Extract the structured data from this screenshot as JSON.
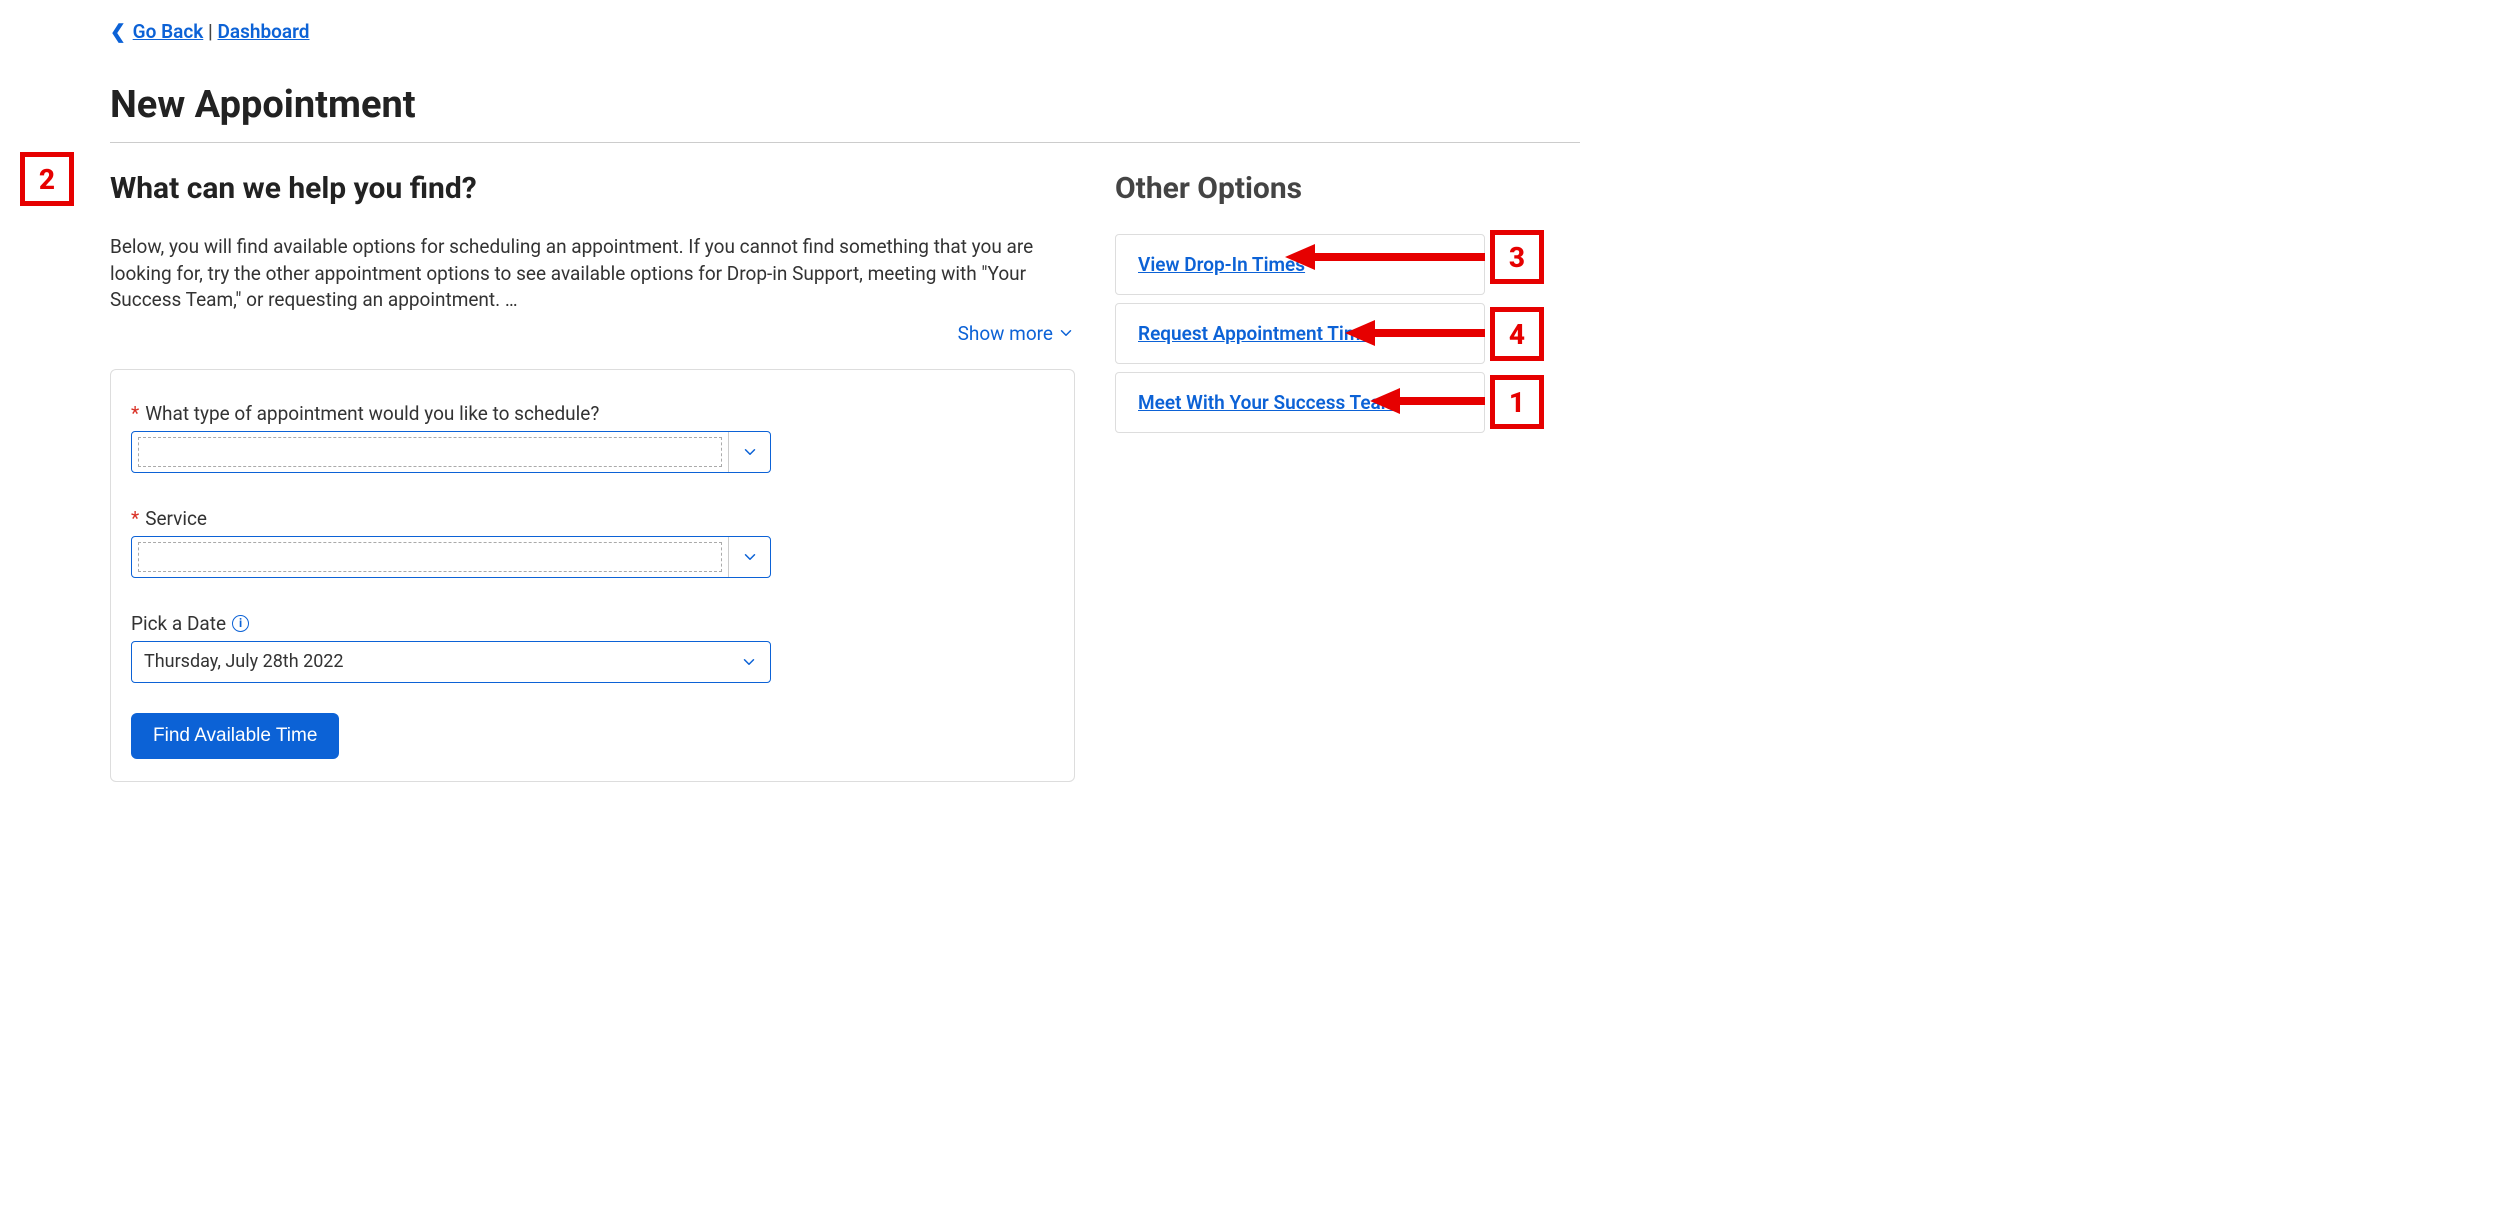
{
  "breadcrumb": {
    "go_back": "Go Back",
    "dashboard": "Dashboard"
  },
  "page_title": "New Appointment",
  "main": {
    "heading": "What can we help you find?",
    "help_text": "Below, you will find available options for scheduling an appointment. If you cannot find something that you are looking for, try the other appointment options to see available options for Drop-in Support, meeting with \"Your Success Team,\" or requesting an appointment. …",
    "show_more": "Show more",
    "form": {
      "appt_type_label": "What type of appointment would you like to schedule?",
      "appt_type_value": "",
      "service_label": "Service",
      "service_value": "",
      "date_label": "Pick a Date",
      "date_value": "Thursday, July 28th 2022",
      "submit_label": "Find Available Time"
    }
  },
  "sidebar": {
    "heading": "Other Options",
    "options": [
      {
        "label": "View Drop-In Times"
      },
      {
        "label": "Request Appointment Time"
      },
      {
        "label": "Meet With Your Success Team"
      }
    ]
  },
  "annotations": {
    "box1": "1",
    "box2": "2",
    "box3": "3",
    "box4": "4"
  }
}
